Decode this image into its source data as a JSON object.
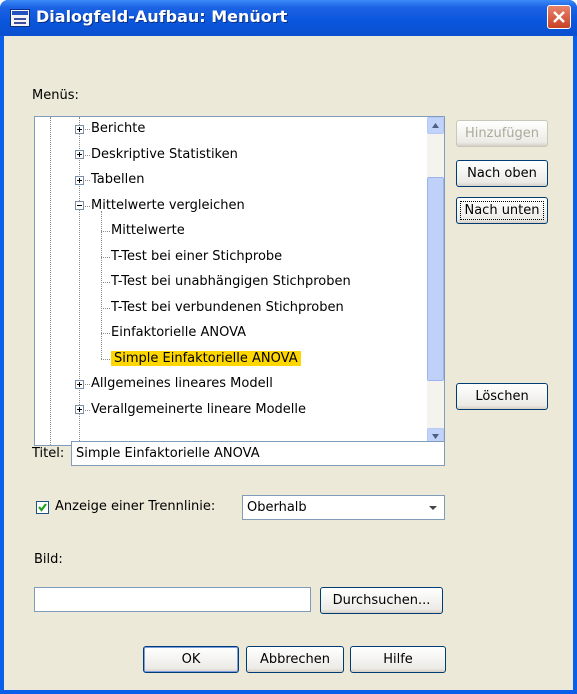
{
  "window": {
    "title": "Dialogfeld-Aufbau: Menüort"
  },
  "labels": {
    "menus": "Menüs:",
    "title_field": "Titel:",
    "separator": "Anzeige einer Trennlinie:",
    "image": "Bild:"
  },
  "tree": {
    "items": [
      {
        "label": "Berichte",
        "level": 0,
        "expander": "plus"
      },
      {
        "label": "Deskriptive Statistiken",
        "level": 0,
        "expander": "plus"
      },
      {
        "label": "Tabellen",
        "level": 0,
        "expander": "plus"
      },
      {
        "label": "Mittelwerte vergleichen",
        "level": 0,
        "expander": "minus"
      },
      {
        "label": "Mittelwerte",
        "level": 1
      },
      {
        "label": "T-Test bei einer Stichprobe",
        "level": 1
      },
      {
        "label": "T-Test bei unabhängigen Stichproben",
        "level": 1
      },
      {
        "label": "T-Test bei verbundenen Stichproben",
        "level": 1
      },
      {
        "label": "Einfaktorielle ANOVA",
        "level": 1
      },
      {
        "label": "Simple Einfaktorielle ANOVA",
        "level": 1,
        "selected": true
      },
      {
        "label": "Allgemeines lineares Modell",
        "level": 0,
        "expander": "plus"
      },
      {
        "label": "Verallgemeinerte lineare Modelle",
        "level": 0,
        "expander": "plus"
      }
    ],
    "selected_color": "#ffd700"
  },
  "buttons": {
    "add": "Hinzufügen",
    "up": "Nach oben",
    "down": "Nach unten",
    "delete": "Löschen",
    "browse": "Durchsuchen...",
    "ok": "OK",
    "cancel": "Abbrechen",
    "help": "Hilfe"
  },
  "fields": {
    "title_value": "Simple Einfaktorielle ANOVA",
    "separator_checked": true,
    "separator_option": "Oberhalb",
    "image_value": ""
  },
  "colors": {
    "titlebar": "#0a56dc",
    "dialog_bg": "#ece9d8",
    "close": "#c94224"
  }
}
